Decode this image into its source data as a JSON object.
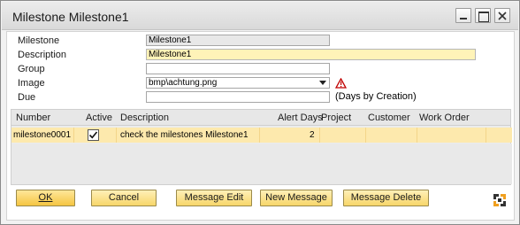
{
  "window": {
    "title": "Milestone Milestone1"
  },
  "form": {
    "milestone": {
      "label": "Milestone",
      "value": "Milestone1"
    },
    "description": {
      "label": "Description",
      "value": "Milestone1"
    },
    "group": {
      "label": "Group",
      "value": ""
    },
    "image": {
      "label": "Image",
      "value": "bmp\\achtung.png",
      "icon": "warning-triangle-icon"
    },
    "due": {
      "label": "Due",
      "value": "",
      "hint": "(Days by Creation)"
    }
  },
  "grid": {
    "headers": [
      "Number",
      "Active",
      "Description",
      "Alert Days",
      "Project",
      "Customer",
      "Work Order"
    ],
    "rows": [
      {
        "number": "milestone0001",
        "active": true,
        "description": "check the milestones Milestone1",
        "alert_days": "2",
        "project": "",
        "customer": "",
        "work_order": ""
      }
    ]
  },
  "buttons": {
    "ok": "OK",
    "cancel": "Cancel",
    "message_edit": "Message Edit",
    "new_message": "New Message",
    "message_delete": "Message Delete"
  },
  "colors": {
    "accent": "#f5c542",
    "selected_row": "#fde9ad",
    "active_field": "#fff3b8",
    "warning": "#c00000"
  }
}
